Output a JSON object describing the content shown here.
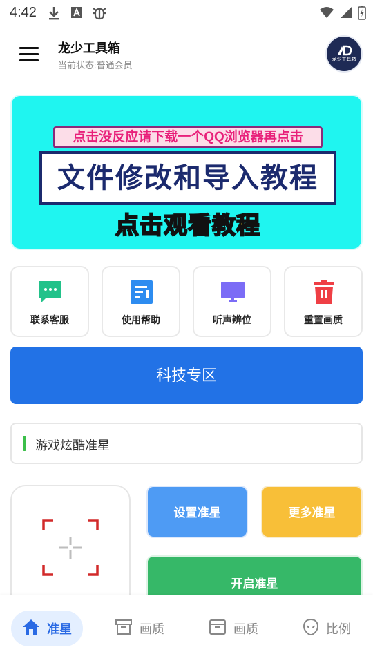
{
  "status_bar": {
    "time": "4:42",
    "icons": [
      "download-icon",
      "text-icon",
      "bug-icon",
      "wifi-icon",
      "signal-icon",
      "battery-charging-icon"
    ]
  },
  "header": {
    "title": "龙少工具箱",
    "status": "当前状态:普通会员",
    "avatar_text": "龙少工具箱"
  },
  "banner": {
    "top_text": "点击没反应请下载一个QQ浏览器再点击",
    "main_text": "文件修改和导入教程",
    "watch_text": "点击观看教程"
  },
  "tiles": [
    {
      "label": "联系客服",
      "icon": "chat-icon",
      "color": "#22c28a"
    },
    {
      "label": "使用帮助",
      "icon": "help-doc-icon",
      "color": "#2d8cf0"
    },
    {
      "label": "听声辨位",
      "icon": "monitor-icon",
      "color": "#7b6cf6"
    },
    {
      "label": "重置画质",
      "icon": "trash-icon",
      "color": "#ef3f45"
    }
  ],
  "tech_button": "科技专区",
  "notice": "游戏炫酷准星",
  "buttons": {
    "set": "设置准星",
    "more": "更多准星",
    "start": "开启准星"
  },
  "nav": [
    {
      "label": "准星",
      "icon": "home-icon",
      "active": true
    },
    {
      "label": "画质",
      "icon": "archive-icon",
      "active": false
    },
    {
      "label": "画质",
      "icon": "archive-icon",
      "active": false
    },
    {
      "label": "比例",
      "icon": "alien-icon",
      "active": false
    }
  ],
  "colors": {
    "primary": "#2272e6",
    "banner_bg": "#1ff5f0",
    "set_button": "#4e9bf4",
    "more_button": "#f8bf38",
    "start_button": "#36b868",
    "crosshair_red": "#d22a2a"
  }
}
